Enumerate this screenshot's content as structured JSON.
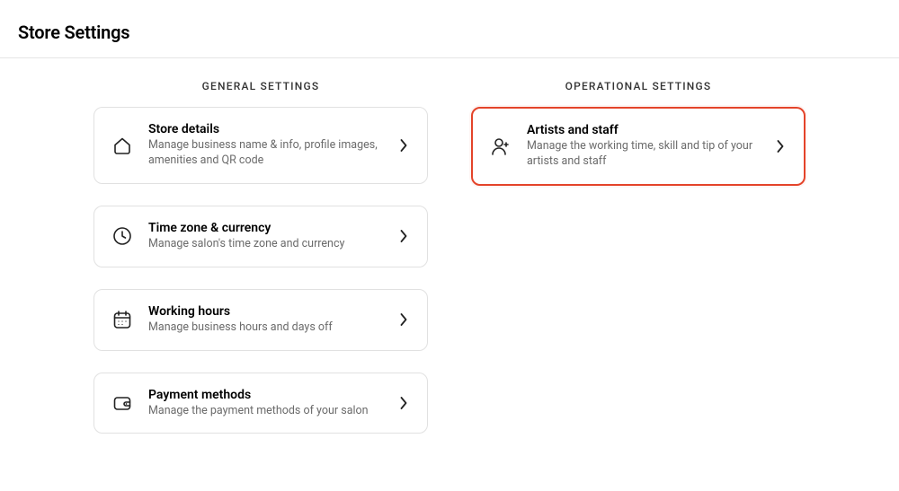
{
  "page_title": "Store Settings",
  "columns": {
    "general": {
      "heading": "GENERAL SETTINGS",
      "items": [
        {
          "id": "store-details",
          "title": "Store details",
          "desc": "Manage business name & info, profile images, amenities and QR code"
        },
        {
          "id": "time-zone-currency",
          "title": "Time zone & currency",
          "desc": "Manage salon's time zone and currency"
        },
        {
          "id": "working-hours",
          "title": "Working hours",
          "desc": "Manage business hours and days off"
        },
        {
          "id": "payment-methods",
          "title": "Payment methods",
          "desc": "Manage the payment methods of your salon"
        }
      ]
    },
    "operational": {
      "heading": "OPERATIONAL SETTINGS",
      "items": [
        {
          "id": "artists-and-staff",
          "title": "Artists and staff",
          "desc": "Manage the working time, skill and tip of your artists and staff"
        }
      ]
    }
  }
}
